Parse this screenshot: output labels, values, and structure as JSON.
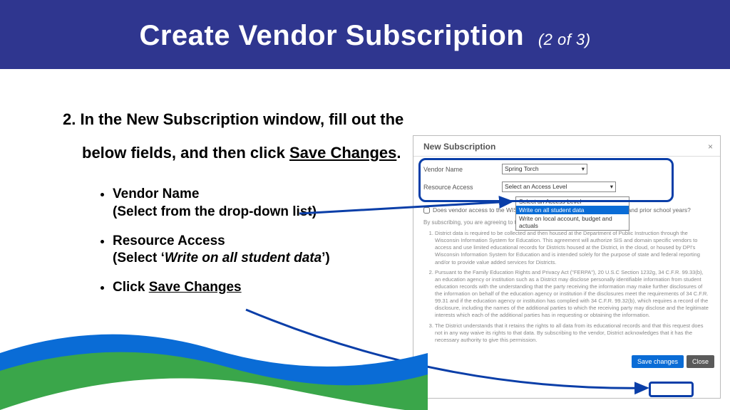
{
  "header": {
    "title": "Create Vendor Subscription",
    "step": "(2 of 3)"
  },
  "instructions": {
    "line1": "2. In the New Subscription window, fill out the",
    "line2_pre": "below fields, and then click ",
    "line2_link": "Save Changes",
    "line2_post": ".",
    "bullets": [
      {
        "title": "Vendor Name",
        "sub_pre": "(Select from the drop-down list)",
        "sub_ital": "",
        "sub_post": ""
      },
      {
        "title": "Resource Access",
        "sub_pre": "(Select ‘",
        "sub_ital": "Write on all student data",
        "sub_post": "’)"
      },
      {
        "title_pre": "Click ",
        "title_link": "Save Changes",
        "sub_pre": "",
        "sub_ital": "",
        "sub_post": ""
      }
    ]
  },
  "dialog": {
    "title": "New Subscription",
    "close_glyph": "×",
    "vendor_label": "Vendor Name",
    "vendor_value": "Spring Torch",
    "access_label": "Resource Access",
    "access_value": "Select an Access Level",
    "dropdown": {
      "opt0": "Select an Access Level",
      "opt1": "Write on all student data",
      "opt2": "Write on local account, budget and actuals"
    },
    "checkbox_label": "Does vendor access to the WISEdata finance submission for the current and prior school years?",
    "agree_intro": "By subscribing, you are agreeing to the following:",
    "agreements": [
      "District data is required to be collected and then housed at the Department of Public Instruction through the Wisconsin Information System for Education. This agreement will authorize SIS and domain specific vendors to access and use limited educational records for Districts housed at the District, in the cloud, or housed by DPI's Wisconsin Information System for Education and is intended solely for the purpose of state and federal reporting and/or to provide value added services for Districts.",
      "Pursuant to the Family Education Rights and Privacy Act (\"FERPA\"), 20 U.S.C Section 1232g, 34 C.F.R. 99.33(b), an education agency or institution such as a District may disclose personally identifiable information from student education records with the understanding that the party receiving the information may make further disclosures of the information on behalf of the education agency or institution if the disclosures meet the requirements of 34 C.F.R. 99.31 and if the education agency or institution has complied with 34 C.F.R. 99.32(b), which requires a record of the disclosure, including the names of the additional parties to which the receiving party may disclose and the legitimate interests which each of the additional parties has in requesting or obtaining the information.",
      "The District understands that it retains the rights to all data from its educational records and that this request does not in any way waive its rights to that data. By subscribing to the vendor, District acknowledges that it has the necessary authority to give this permission."
    ],
    "save_label": "Save changes",
    "close_label": "Close"
  }
}
